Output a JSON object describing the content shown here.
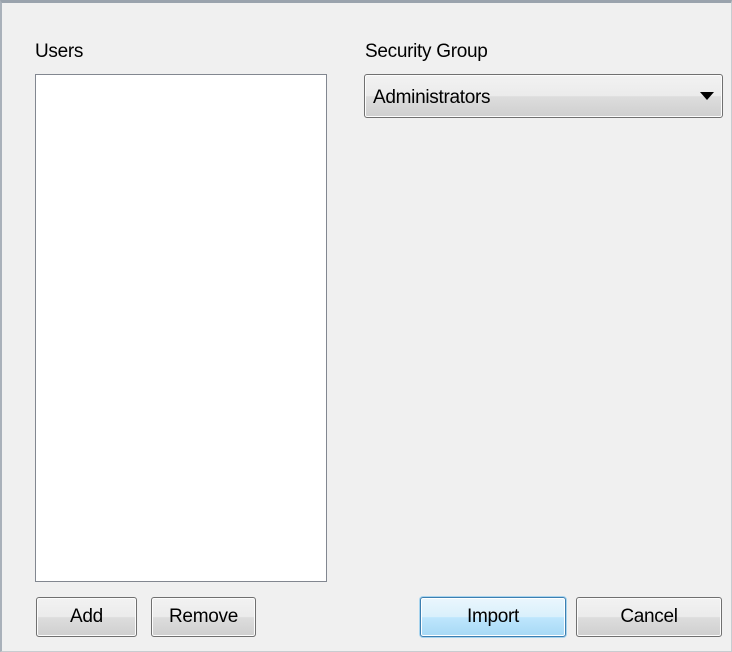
{
  "users": {
    "label": "Users",
    "items": []
  },
  "security_group": {
    "label": "Security Group",
    "selected": "Administrators"
  },
  "buttons": {
    "add": "Add",
    "remove": "Remove",
    "import": "Import",
    "cancel": "Cancel"
  },
  "colors": {
    "background": "#f0f0f0",
    "list_background": "#ffffff",
    "default_button_accent": "#3c7fb1"
  }
}
